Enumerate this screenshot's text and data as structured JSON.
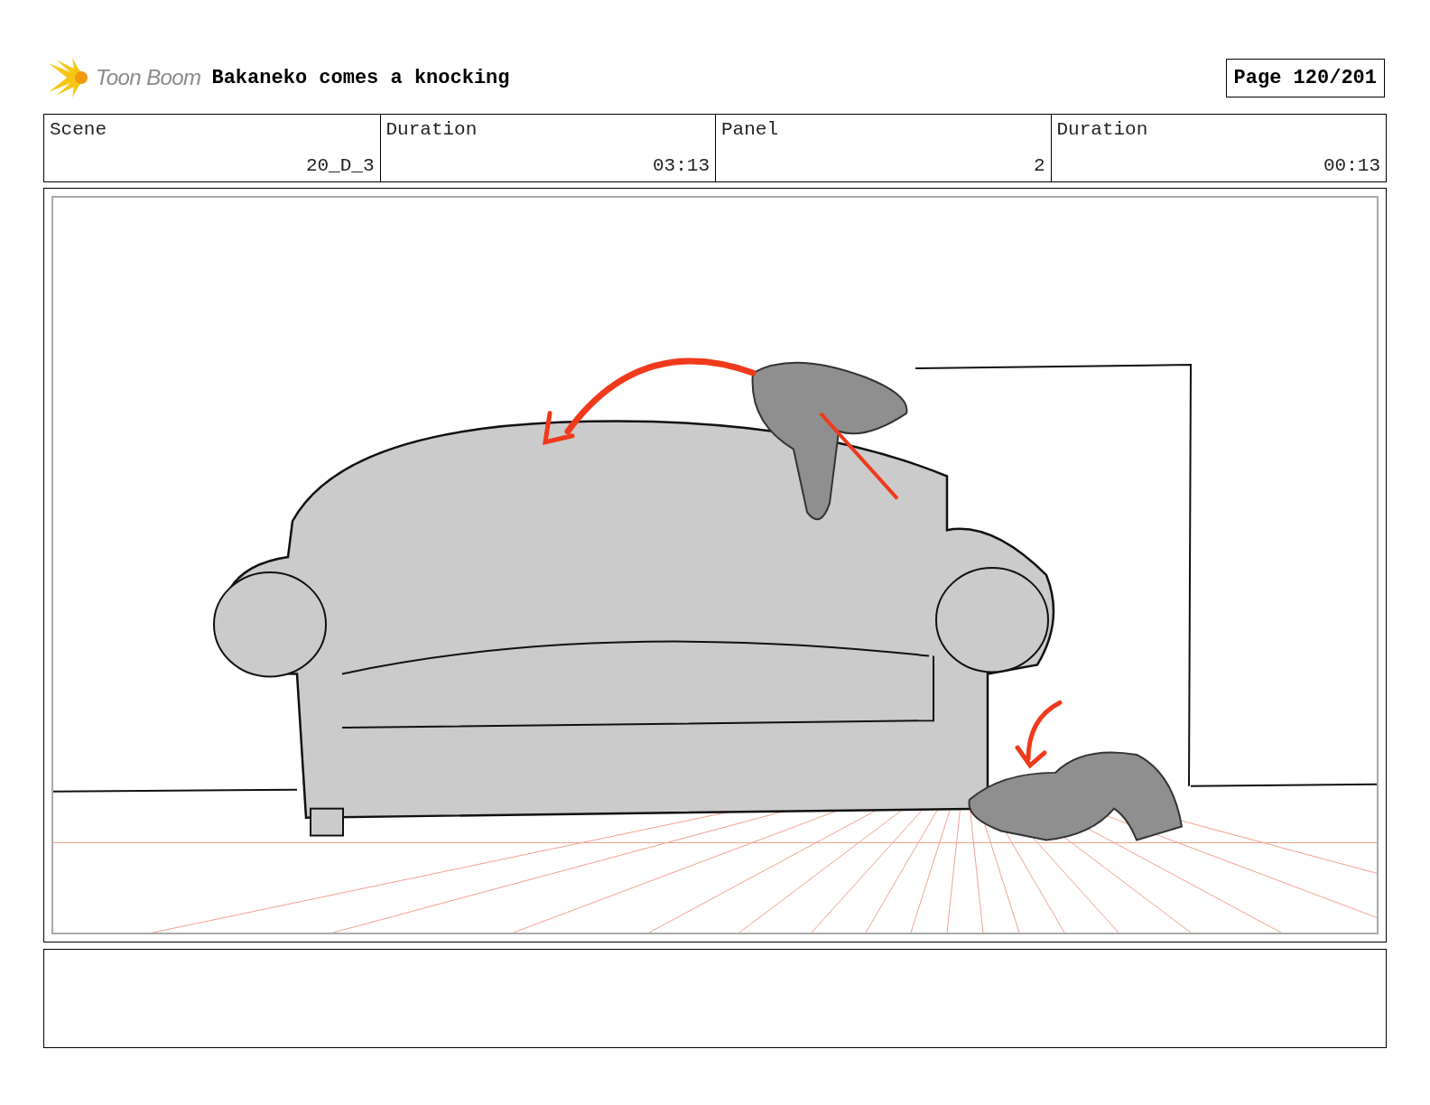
{
  "logo": {
    "text": "Toon Boom"
  },
  "title": "Bakaneko comes a knocking",
  "page": "Page 120/201",
  "info_table": {
    "labels": [
      "Scene",
      "Duration",
      "Panel",
      "Duration"
    ],
    "values": [
      "20_D_3",
      "03:13",
      "2",
      "00:13"
    ]
  }
}
